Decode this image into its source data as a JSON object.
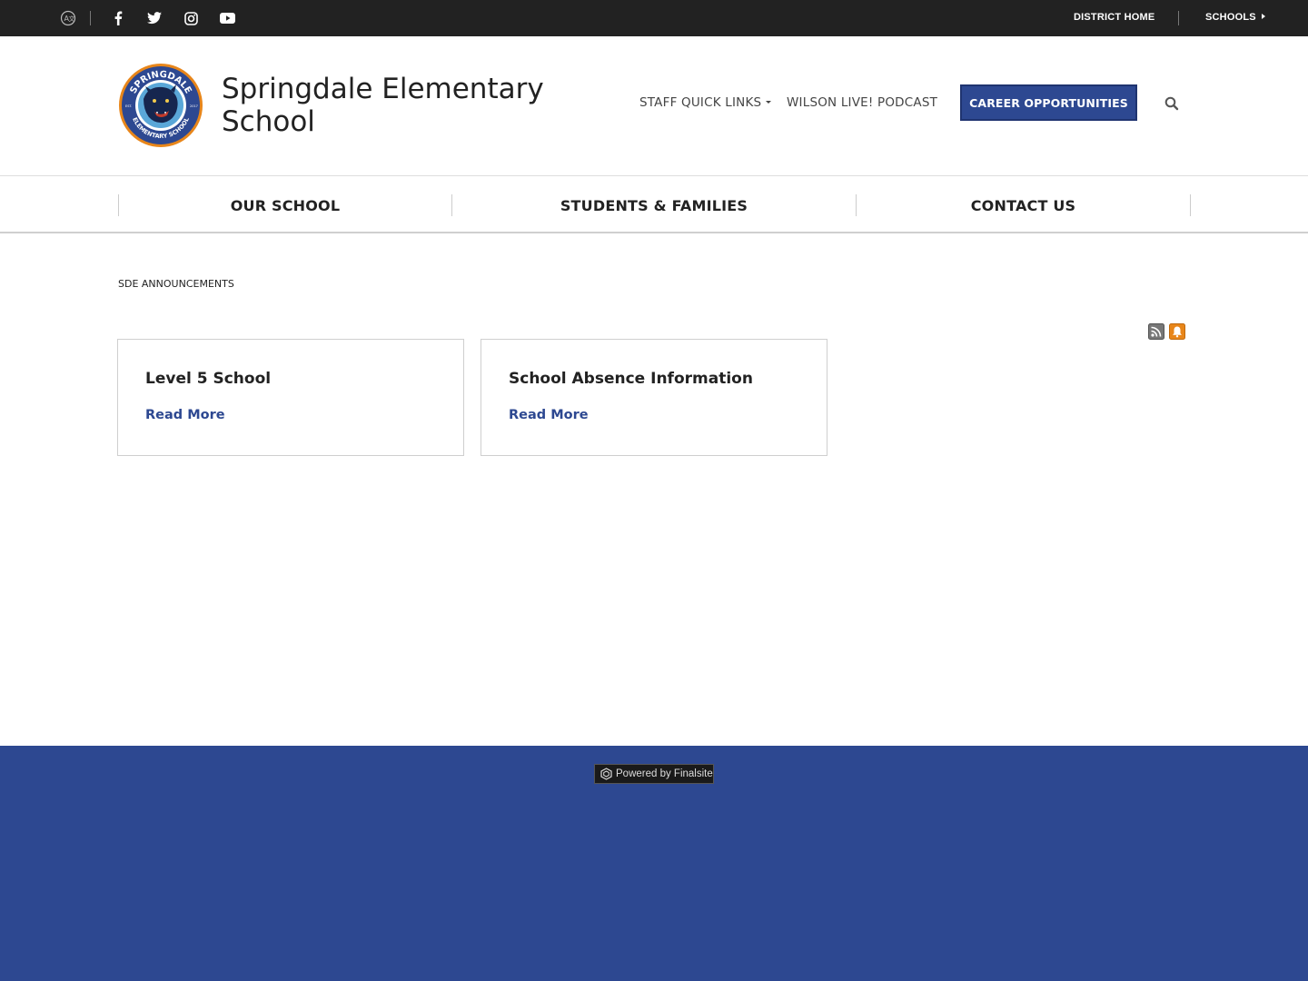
{
  "topbar": {
    "icons": [
      "translate-icon",
      "facebook-icon",
      "twitter-icon",
      "instagram-icon",
      "youtube-icon"
    ],
    "district_home": "DISTRICT HOME",
    "schools": "SCHOOLS"
  },
  "header": {
    "school_name": "Springdale Elementary School",
    "logo_text": {
      "top": "SPRINGDALE",
      "bottom": "ELEMENTARY SCHOOL",
      "left": "EST.",
      "right": "2017"
    },
    "staff_quick_links": "STAFF QUICK LINKS",
    "podcast": "WILSON LIVE! PODCAST",
    "career_button": "CAREER OPPORTUNITIES"
  },
  "nav": {
    "items": [
      {
        "label": "OUR SCHOOL"
      },
      {
        "label": "STUDENTS & FAMILIES"
      },
      {
        "label": "CONTACT US"
      }
    ]
  },
  "content": {
    "breadcrumb": "SDE ANNOUNCEMENTS",
    "cards": [
      {
        "title": "Level 5 School",
        "link": "Read More"
      },
      {
        "title": "School Absence Information",
        "link": "Read More"
      }
    ]
  },
  "footer": {
    "powered_by": "Powered by Finalsite"
  },
  "colors": {
    "brand_blue": "#2d4891",
    "topbar": "#222222",
    "bell_orange": "#e8861a"
  }
}
